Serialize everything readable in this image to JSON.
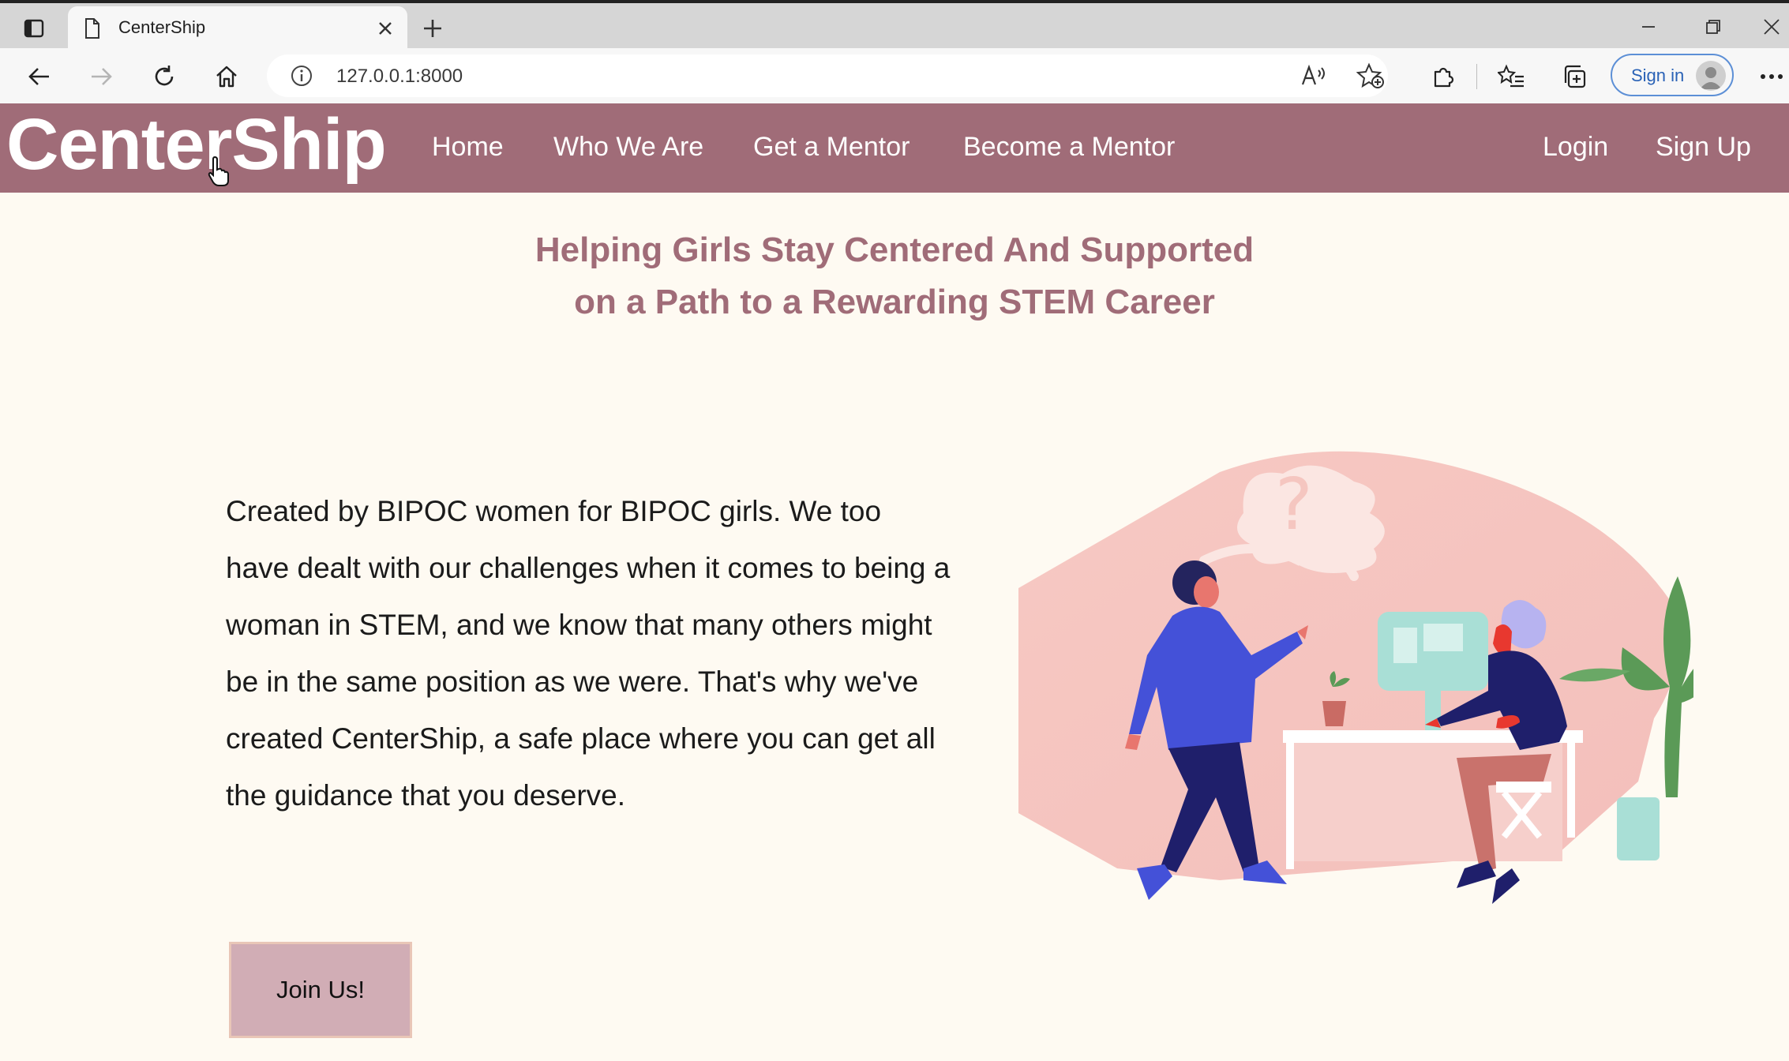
{
  "browser": {
    "tab_title": "CenterShip",
    "url": "127.0.0.1:8000",
    "sign_in_label": "Sign in"
  },
  "site": {
    "logo": "CenterShip",
    "nav": {
      "home": "Home",
      "who_we_are": "Who We Are",
      "get_a_mentor": "Get a Mentor",
      "become_a_mentor": "Become a Mentor",
      "login": "Login",
      "sign_up": "Sign Up"
    },
    "hero_title_line1": "Helping Girls Stay Centered And Supported",
    "hero_title_line2": "on a Path to a Rewarding STEM Career",
    "intro_text": "Created by BIPOC women for BIPOC girls. We too have dealt with our challenges when it comes to being a woman in STEM, and we know that many others might be in the same position as we were. That's why we've created CenterShip, a safe place where you can get all the guidance that you deserve.",
    "join_button": "Join Us!"
  },
  "colors": {
    "nav_background": "#a06c78",
    "page_background": "#fefaf2",
    "accent_text": "#a06c78",
    "button_background": "#d1adb5",
    "illustration_blob": "#f6c6c1"
  }
}
